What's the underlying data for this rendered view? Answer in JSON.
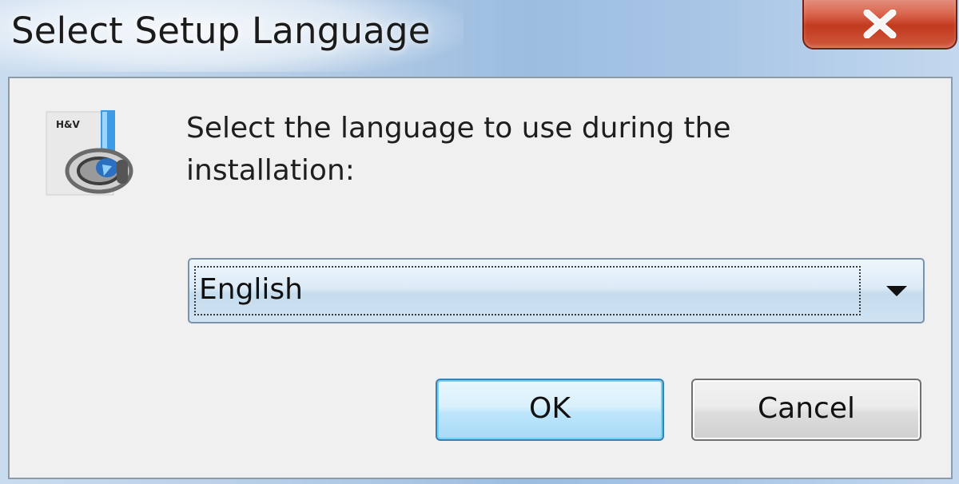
{
  "window": {
    "title": "Select Setup Language",
    "close_icon": "close-icon"
  },
  "dialog": {
    "app_icon": "installer-app-icon",
    "prompt_line1": "Select the language to use during the",
    "prompt_line2": "installation:",
    "language_select": {
      "selected": "English",
      "arrow_icon": "dropdown-arrow-icon"
    },
    "buttons": {
      "ok_label": "OK",
      "cancel_label": "Cancel"
    }
  },
  "colors": {
    "close_button": "#c23a1e",
    "ok_button_border": "#3c7fb1",
    "client_background": "#f0f0f0"
  }
}
